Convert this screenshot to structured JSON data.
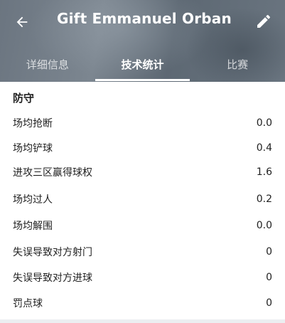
{
  "header": {
    "title": "Gift Emmanuel Orban",
    "back_icon": "arrow-left-icon",
    "edit_icon": "pencil-icon"
  },
  "tabs": [
    {
      "label": "详细信息",
      "active": false
    },
    {
      "label": "技术统计",
      "active": true
    },
    {
      "label": "比赛",
      "active": false
    }
  ],
  "section": {
    "title": "防守",
    "stats": [
      {
        "label": "场均抢断",
        "value": "0.0"
      },
      {
        "label": "场均铲球",
        "value": "0.4"
      },
      {
        "label": "进攻三区赢得球权",
        "value": "1.6"
      },
      {
        "label": "场均过人",
        "value": "0.2"
      },
      {
        "label": "场均解围",
        "value": "0.0"
      },
      {
        "label": "失误导致对方射门",
        "value": "0"
      },
      {
        "label": "失误导致对方进球",
        "value": "0"
      },
      {
        "label": "罚点球",
        "value": "0"
      }
    ]
  },
  "colors": {
    "header_bg": "#6b7580",
    "text": "#212121",
    "active_indicator": "#ffffff"
  }
}
